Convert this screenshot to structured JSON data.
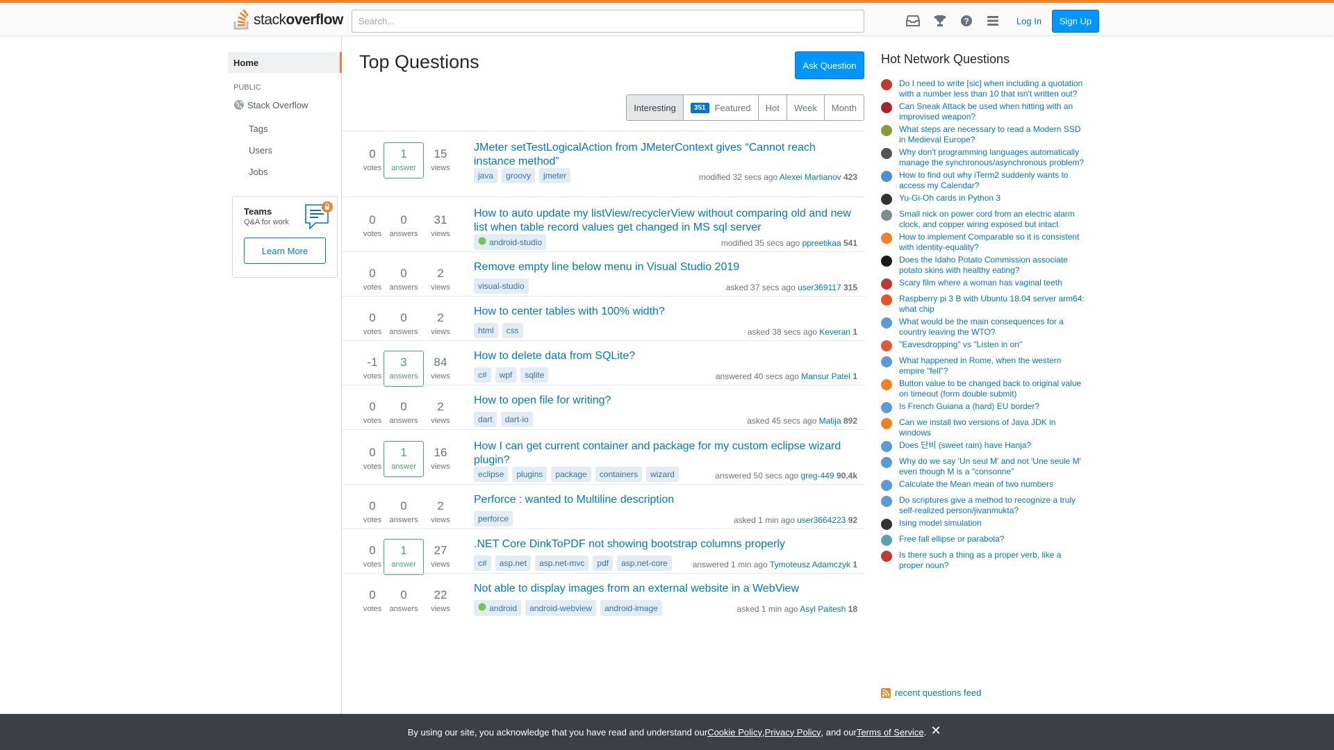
{
  "topbar": {
    "logo_light": "stack",
    "logo_bold": "overflow",
    "search_placeholder": "Search...",
    "icons": [
      "inbox-icon",
      "achievements-icon",
      "help-icon",
      "site-switcher-icon"
    ],
    "login_label": "Log In",
    "signup_label": "Sign Up"
  },
  "leftnav": {
    "home": "Home",
    "public_heading": "PUBLIC",
    "stackoverflow": "Stack Overflow",
    "tags": "Tags",
    "users": "Users",
    "jobs": "Jobs",
    "teams_title": "Teams",
    "teams_sub": "Q&A for work",
    "teams_button": "Learn More"
  },
  "main": {
    "title": "Top Questions",
    "ask_button": "Ask Question",
    "filters": {
      "interesting": "Interesting",
      "featured_count": "351",
      "featured": "Featured",
      "hot": "Hot",
      "week": "Week",
      "month": "Month"
    },
    "questions": [
      {
        "votes": "0",
        "votes_label": "votes",
        "answers": "1",
        "answers_label": "answer",
        "answered": true,
        "views": "15",
        "views_label": "views",
        "title": "JMeter setTestLogicalAction from JMeterContext gives “Cannot reach instance method”",
        "tags": [
          "java",
          "groovy",
          "jmeter"
        ],
        "action": "modified 32 secs ago",
        "user": "Alexei Martianov",
        "rep": "423"
      },
      {
        "votes": "0",
        "votes_label": "votes",
        "answers": "0",
        "answers_label": "answers",
        "answered": false,
        "views": "31",
        "views_label": "views",
        "title": "How to auto update my listView/recyclerView without comparing old and new list when table record values get changed in MS sql server",
        "tags": [
          "android-studio"
        ],
        "action": "modified 35 secs ago",
        "user": "ppreetikaa",
        "rep": "541"
      },
      {
        "votes": "0",
        "votes_label": "votes",
        "answers": "0",
        "answers_label": "answers",
        "answered": false,
        "views": "2",
        "views_label": "views",
        "title": "Remove empty line below menu in Visual Studio 2019",
        "tags": [
          "visual-studio"
        ],
        "action": "asked 37 secs ago",
        "user": "user369117",
        "rep": "315"
      },
      {
        "votes": "0",
        "votes_label": "votes",
        "answers": "0",
        "answers_label": "answers",
        "answered": false,
        "views": "2",
        "views_label": "views",
        "title": "How to center tables with 100% width?",
        "tags": [
          "html",
          "css"
        ],
        "action": "asked 38 secs ago",
        "user": "Keveran",
        "rep": "1"
      },
      {
        "votes": "-1",
        "votes_label": "votes",
        "answers": "3",
        "answers_label": "answers",
        "answered": true,
        "views": "84",
        "views_label": "views",
        "title": "How to delete data from SQLite?",
        "tags": [
          "c#",
          "wpf",
          "sqlite"
        ],
        "action": "answered 40 secs ago",
        "user": "Mansur Patel",
        "rep": "1"
      },
      {
        "votes": "0",
        "votes_label": "votes",
        "answers": "0",
        "answers_label": "answers",
        "answered": false,
        "views": "2",
        "views_label": "views",
        "title": "How to open file for writing?",
        "tags": [
          "dart",
          "dart-io"
        ],
        "action": "asked 45 secs ago",
        "user": "Matija",
        "rep": "892"
      },
      {
        "votes": "0",
        "votes_label": "votes",
        "answers": "1",
        "answers_label": "answer",
        "answered": true,
        "views": "16",
        "views_label": "views",
        "title": "How I can get current container and package for my custom eclipse wizard plugin?",
        "tags": [
          "eclipse",
          "plugins",
          "package",
          "containers",
          "wizard"
        ],
        "action": "answered 50 secs ago",
        "user": "greg-449",
        "rep": "90.4k"
      },
      {
        "votes": "0",
        "votes_label": "votes",
        "answers": "0",
        "answers_label": "answers",
        "answered": false,
        "views": "2",
        "views_label": "views",
        "title": "Perforce : wanted to Multiline description",
        "tags": [
          "perforce"
        ],
        "action": "asked 1 min ago",
        "user": "user3664223",
        "rep": "92"
      },
      {
        "votes": "0",
        "votes_label": "votes",
        "answers": "1",
        "answers_label": "answer",
        "answered": true,
        "views": "27",
        "views_label": "views",
        "title": ".NET Core DinkToPDF not showing bootstrap columns properly",
        "tags": [
          "c#",
          "asp.net",
          "asp.net-mvc",
          "pdf",
          "asp.net-core"
        ],
        "action": "answered 1 min ago",
        "user": "Tymoteusz Adamczyk",
        "rep": "1"
      },
      {
        "votes": "0",
        "votes_label": "votes",
        "answers": "0",
        "answers_label": "answers",
        "answered": false,
        "views": "22",
        "views_label": "views",
        "title": "Not able to display images from an external website in a WebView",
        "tags": [
          "android",
          "android-webview",
          "android-image"
        ],
        "action": "asked 1 min ago",
        "user": "Asyl Paitesh",
        "rep": "18"
      }
    ]
  },
  "hot_network": {
    "title": "Hot Network Questions",
    "items": [
      {
        "text": "Do I need to write [sic] when including a quotation with a number less than 10 that isn't written out?",
        "icon_color": "#c0392b"
      },
      {
        "text": "Can Sneak Attack be used when hitting with an improvised weapon?",
        "icon_color": "#a8232e"
      },
      {
        "text": "What steps are necessary to read a Modern SSD in Medieval Europe?",
        "icon_color": "#8a9a3b"
      },
      {
        "text": "Why don't programming languages automatically manage the synchronous/asynchronous problem?",
        "icon_color": "#555555"
      },
      {
        "text": "How to find out why iTerm2 suddenly wants to access my Calendar?",
        "icon_color": "#4a90d9"
      },
      {
        "text": "Yu-Gi-Oh cards in Python 3",
        "icon_color": "#333333"
      },
      {
        "text": "Small nick on power cord from an electric alarm clock, and copper wiring exposed but intact",
        "icon_color": "#7f8c8d"
      },
      {
        "text": "How to implement Comparable so it is consistent with identity-equality?",
        "icon_color": "#f48024"
      },
      {
        "text": "Does the Idaho Potato Commission associate potato skins with healthy eating?",
        "icon_color": "#1a1a1a"
      },
      {
        "text": "Scary film where a woman has vaginal teeth",
        "icon_color": "#c0392b"
      },
      {
        "text": "Raspberry pi 3 B with Ubuntu 18.04 server arm64: what chip",
        "icon_color": "#e95420"
      },
      {
        "text": "What would be the main consequences for a country leaving the WTO?",
        "icon_color": "#5b9bd5"
      },
      {
        "text": "\"Eavesdropping\" vs \"Listen in on\"",
        "icon_color": "#e05a3a"
      },
      {
        "text": "What happened in Rome, when the western empire \"fell\"?",
        "icon_color": "#5b9bd5"
      },
      {
        "text": "Button value to be changed back to original value on timeout (form double submit)",
        "icon_color": "#f48024"
      },
      {
        "text": "Is French Guiana a (hard) EU border?",
        "icon_color": "#5b9bd5"
      },
      {
        "text": "Can we install two versions of Java JDK in windows",
        "icon_color": "#f48024"
      },
      {
        "text": "Does 단비 (sweet rain) have Hanja?",
        "icon_color": "#5b9bd5"
      },
      {
        "text": "Why do we say 'Un seul M' and not 'Une seule M' even though M is a \"consonne\"",
        "icon_color": "#5b9bd5"
      },
      {
        "text": "Calculate the Mean mean of two numbers",
        "icon_color": "#5b9bd5"
      },
      {
        "text": "Do scriptures give a method to recognize a truly self-realized person/jivanmukta?",
        "icon_color": "#5b9bd5"
      },
      {
        "text": "Ising model simulation",
        "icon_color": "#333333"
      },
      {
        "text": "Free fall ellipse or parabola?",
        "icon_color": "#5ba3a8"
      },
      {
        "text": "Is there such a thing as a proper verb, like a proper noun?",
        "icon_color": "#c0392b"
      }
    ],
    "feed_label": "recent questions feed"
  },
  "cookie": {
    "prefix": "By using our site, you acknowledge that you have read and understand our ",
    "cookie_policy": "Cookie Policy",
    "comma1": ", ",
    "privacy_policy": "Privacy Policy",
    "and_our": ", and our ",
    "terms": "Terms of Service",
    "period": ".",
    "close": "✕"
  }
}
